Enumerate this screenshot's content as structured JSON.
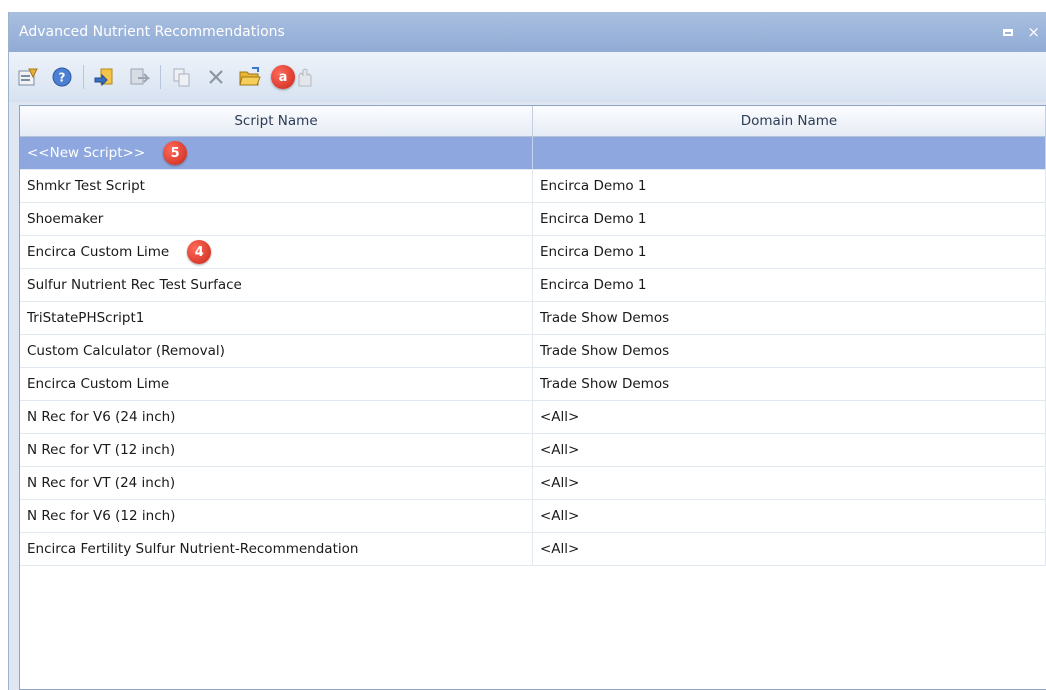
{
  "window": {
    "title": "Advanced Nutrient Recommendations",
    "restore_icon": "restore-icon",
    "close_label": "×"
  },
  "toolbar": {
    "tools": [
      "properties-icon",
      "help-icon",
      "import-icon",
      "export-icon",
      "copy-icon",
      "delete-icon",
      "open-folder-icon",
      "hand-icon"
    ],
    "callout_a": "a"
  },
  "table": {
    "columns": [
      "Script Name",
      "Domain Name"
    ],
    "new_row": {
      "script": "<<New Script>>",
      "domain": "",
      "callout": "5"
    },
    "rows": [
      {
        "script": "Shmkr Test Script",
        "domain": "Encirca Demo 1"
      },
      {
        "script": "Shoemaker",
        "domain": "Encirca Demo 1"
      },
      {
        "script": "Encirca Custom Lime",
        "domain": "Encirca Demo 1",
        "callout": "4"
      },
      {
        "script": "Sulfur Nutrient Rec Test Surface",
        "domain": "Encirca Demo 1"
      },
      {
        "script": "TriStatePHScript1",
        "domain": "Trade Show Demos"
      },
      {
        "script": "Custom Calculator (Removal)",
        "domain": "Trade Show Demos"
      },
      {
        "script": "Encirca Custom Lime",
        "domain": "Trade Show Demos"
      },
      {
        "script": "N Rec for V6 (24 inch)",
        "domain": "<All>"
      },
      {
        "script": "N Rec for VT (12 inch)",
        "domain": "<All>"
      },
      {
        "script": "N Rec for VT (24 inch)",
        "domain": "<All>"
      },
      {
        "script": "N Rec for V6 (12 inch)",
        "domain": "<All>"
      },
      {
        "script": "Encirca Fertility Sulfur Nutrient-Recommendation",
        "domain": "<All>"
      }
    ]
  },
  "colors": {
    "selected_row": "#8ea8df",
    "titlebar": "#90abd5",
    "callout": "#d93a2b"
  }
}
